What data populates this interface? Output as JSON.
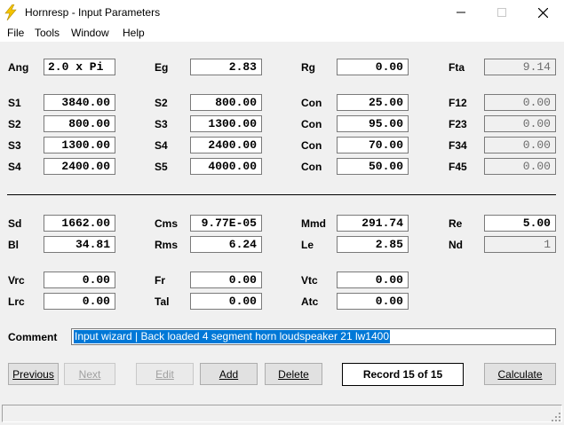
{
  "window": {
    "title": "Hornresp - Input Parameters"
  },
  "menu": [
    "File",
    "Tools",
    "Window",
    "Help"
  ],
  "row_top": {
    "ang": {
      "label": "Ang",
      "value": "2.0 x Pi"
    },
    "eg": {
      "label": "Eg",
      "value": "2.83"
    },
    "rg": {
      "label": "Rg",
      "value": "0.00"
    },
    "fta": {
      "label": "Fta",
      "value": "9.14"
    }
  },
  "segments": [
    {
      "s_label": "S1",
      "s_value": "3840.00",
      "s2_label": "S2",
      "s2_value": "800.00",
      "con_label": "Con",
      "con_value": "25.00",
      "f_label": "F12",
      "f_value": "0.00"
    },
    {
      "s_label": "S2",
      "s_value": "800.00",
      "s2_label": "S3",
      "s2_value": "1300.00",
      "con_label": "Con",
      "con_value": "95.00",
      "f_label": "F23",
      "f_value": "0.00"
    },
    {
      "s_label": "S3",
      "s_value": "1300.00",
      "s2_label": "S4",
      "s2_value": "2400.00",
      "con_label": "Con",
      "con_value": "70.00",
      "f_label": "F34",
      "f_value": "0.00"
    },
    {
      "s_label": "S4",
      "s_value": "2400.00",
      "s2_label": "S5",
      "s2_value": "4000.00",
      "con_label": "Con",
      "con_value": "50.00",
      "f_label": "F45",
      "f_value": "0.00"
    }
  ],
  "driver": {
    "sd": {
      "label": "Sd",
      "value": "1662.00"
    },
    "cms": {
      "label": "Cms",
      "value": "9.77E-05"
    },
    "mmd": {
      "label": "Mmd",
      "value": "291.74"
    },
    "re": {
      "label": "Re",
      "value": "5.00"
    },
    "bl": {
      "label": "Bl",
      "value": "34.81"
    },
    "rms": {
      "label": "Rms",
      "value": "6.24"
    },
    "le": {
      "label": "Le",
      "value": "2.85"
    },
    "nd": {
      "label": "Nd",
      "value": "1"
    }
  },
  "chambers": {
    "vrc": {
      "label": "Vrc",
      "value": "0.00"
    },
    "fr": {
      "label": "Fr",
      "value": "0.00"
    },
    "vtc": {
      "label": "Vtc",
      "value": "0.00"
    },
    "lrc": {
      "label": "Lrc",
      "value": "0.00"
    },
    "tal": {
      "label": "Tal",
      "value": "0.00"
    },
    "atc": {
      "label": "Atc",
      "value": "0.00"
    }
  },
  "comment": {
    "label": "Comment",
    "value": "Input wizard | Back loaded 4 segment horn loudspeaker 21 lw1400"
  },
  "buttons": {
    "previous": "Previous",
    "next": "Next",
    "edit": "Edit",
    "add": "Add",
    "delete": "Delete",
    "calculate": "Calculate"
  },
  "record": "Record 15 of 15",
  "colors": {
    "selection": "#0078d7",
    "icon": "#f5c400"
  }
}
